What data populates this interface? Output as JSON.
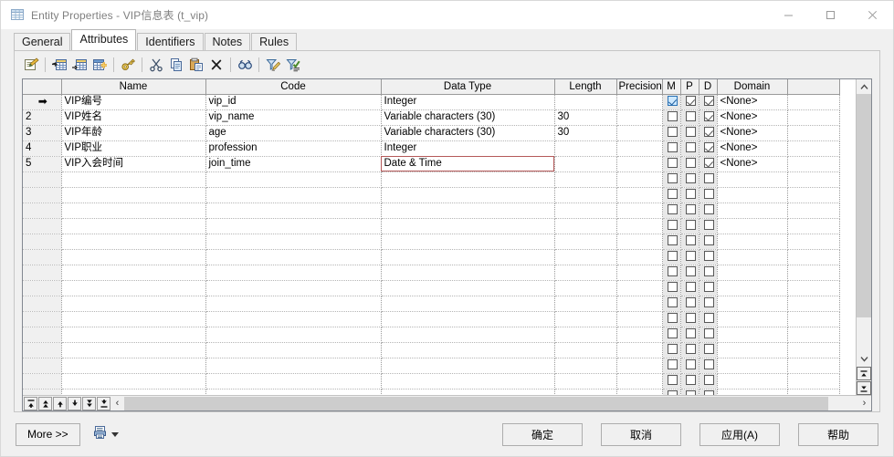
{
  "window": {
    "title": "Entity Properties - VIP信息表 (t_vip)",
    "title_icon": "table-icon",
    "minimize_label": "—",
    "maximize_label": "□",
    "close_label": "✕"
  },
  "tabs": [
    {
      "label": "General",
      "active": false
    },
    {
      "label": "Attributes",
      "active": true
    },
    {
      "label": "Identifiers",
      "active": false
    },
    {
      "label": "Notes",
      "active": false
    },
    {
      "label": "Rules",
      "active": false
    }
  ],
  "toolbar": [
    {
      "name": "properties-icon",
      "title": "Properties"
    },
    {
      "name": "separator"
    },
    {
      "name": "insert-row-icon",
      "title": "Insert a Row"
    },
    {
      "name": "add-row-icon",
      "title": "Add a Row"
    },
    {
      "name": "add-object-icon",
      "title": "Add Objects"
    },
    {
      "name": "separator"
    },
    {
      "name": "key-icon",
      "title": "Create Identifier"
    },
    {
      "name": "separator"
    },
    {
      "name": "cut-icon",
      "title": "Cut"
    },
    {
      "name": "copy-icon",
      "title": "Copy"
    },
    {
      "name": "paste-icon",
      "title": "Paste"
    },
    {
      "name": "delete-icon",
      "title": "Delete"
    },
    {
      "name": "separator"
    },
    {
      "name": "find-icon",
      "title": "Find"
    },
    {
      "name": "separator"
    },
    {
      "name": "filter-edit-icon",
      "title": "Customize Filter"
    },
    {
      "name": "filter-apply-icon",
      "title": "Apply Filter"
    }
  ],
  "grid": {
    "columns": [
      {
        "key": "rownum",
        "label": ""
      },
      {
        "key": "name",
        "label": "Name"
      },
      {
        "key": "code",
        "label": "Code"
      },
      {
        "key": "datatype",
        "label": "Data Type"
      },
      {
        "key": "length",
        "label": "Length"
      },
      {
        "key": "precision",
        "label": "Precision"
      },
      {
        "key": "m",
        "label": "M"
      },
      {
        "key": "p",
        "label": "P"
      },
      {
        "key": "d",
        "label": "D"
      },
      {
        "key": "domain",
        "label": "Domain"
      },
      {
        "key": "extra",
        "label": ""
      }
    ],
    "rows": [
      {
        "rownum": "",
        "current": true,
        "name": "VIP编号",
        "code": "vip_id",
        "datatype": "Integer",
        "length": "",
        "precision": "",
        "m": true,
        "p": true,
        "d": true,
        "m_selected": true,
        "domain": "<None>",
        "focus": null
      },
      {
        "rownum": "2",
        "current": false,
        "name": "VIP姓名",
        "code": "vip_name",
        "datatype": "Variable characters (30)",
        "length": "30",
        "precision": "",
        "m": false,
        "p": false,
        "d": true,
        "m_selected": false,
        "domain": "<None>",
        "focus": null
      },
      {
        "rownum": "3",
        "current": false,
        "name": "VIP年龄",
        "code": "age",
        "datatype": "Variable characters (30)",
        "length": "30",
        "precision": "",
        "m": false,
        "p": false,
        "d": true,
        "m_selected": false,
        "domain": "<None>",
        "focus": null
      },
      {
        "rownum": "4",
        "current": false,
        "name": "VIP职业",
        "code": "profession",
        "datatype": "Integer",
        "length": "",
        "precision": "",
        "m": false,
        "p": false,
        "d": true,
        "m_selected": false,
        "domain": "<None>",
        "focus": null
      },
      {
        "rownum": "5",
        "current": false,
        "name": "VIP入会时间",
        "code": "join_time",
        "datatype": "Date & Time",
        "length": "",
        "precision": "",
        "m": false,
        "p": false,
        "d": true,
        "m_selected": false,
        "domain": "<None>",
        "focus": "datatype"
      }
    ],
    "empty_row_count": 15
  },
  "grid_nav": [
    {
      "name": "nav-first-button",
      "glyph": "⤒"
    },
    {
      "name": "nav-page-up-button",
      "glyph": "⇞"
    },
    {
      "name": "nav-prev-button",
      "glyph": "↑"
    },
    {
      "name": "nav-next-button",
      "glyph": "↓"
    },
    {
      "name": "nav-page-down-button",
      "glyph": "⇟"
    },
    {
      "name": "nav-last-button",
      "glyph": "⤓"
    }
  ],
  "scrollbars": {
    "h_left_arrow": "‹",
    "h_right_arrow": "›",
    "v_up_arrow": "⌃",
    "v_down_arrow": "⌄",
    "v_extra_up": "⤒",
    "v_extra_down": "⤓"
  },
  "footer": {
    "more_label": "More >>",
    "report_icon": "report-icon",
    "dropdown_icon": "chevron-down-icon",
    "buttons": [
      {
        "label": "确定",
        "name": "ok-button"
      },
      {
        "label": "取消",
        "name": "cancel-button"
      },
      {
        "label": "应用(A)",
        "name": "apply-button"
      },
      {
        "label": "帮助",
        "name": "help-button"
      }
    ]
  },
  "colors": {
    "dialog_bg": "#f0f0f0",
    "grid_bg": "#ffffff",
    "header_bg": "#f0f0f0",
    "focus_border": "#b55a5a",
    "selected_check": "#cde8ff",
    "title_text": "#808080"
  }
}
